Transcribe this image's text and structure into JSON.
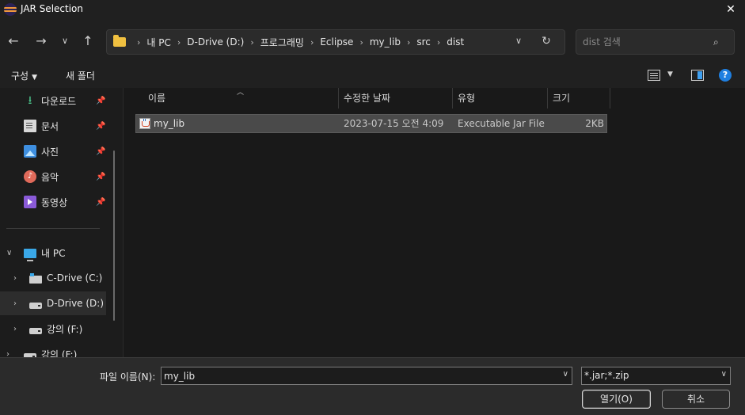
{
  "window": {
    "title": "JAR Selection"
  },
  "nav": {
    "breadcrumbs": [
      "내 PC",
      "D-Drive (D:)",
      "프로그래밍",
      "Eclipse",
      "my_lib",
      "src",
      "dist"
    ],
    "search_placeholder": "dist 검색"
  },
  "toolbar": {
    "organize": "구성",
    "new_folder": "새 폴더"
  },
  "sidebar": {
    "quick_access": [
      {
        "label": "다운로드",
        "icon": "download-icon"
      },
      {
        "label": "문서",
        "icon": "document-icon"
      },
      {
        "label": "사진",
        "icon": "picture-icon"
      },
      {
        "label": "음악",
        "icon": "music-icon"
      },
      {
        "label": "동영상",
        "icon": "video-icon"
      }
    ],
    "pc": {
      "label": "내 PC",
      "drives": [
        {
          "label": "C-Drive (C:)"
        },
        {
          "label": "D-Drive (D:)"
        },
        {
          "label": "강의 (F:)"
        },
        {
          "label": "강의 (F:)"
        }
      ]
    }
  },
  "columns": {
    "name": "이름",
    "date": "수정한 날짜",
    "type": "유형",
    "size": "크기"
  },
  "files": [
    {
      "name": "my_lib",
      "date": "2023-07-15 오전 4:09",
      "type": "Executable Jar File",
      "size": "2KB"
    }
  ],
  "footer": {
    "filename_label": "파일 이름(N):",
    "filename_value": "my_lib",
    "filter_value": "*.jar;*.zip",
    "open_label": "열기(O)",
    "cancel_label": "취소"
  },
  "colors": {
    "accent": "#1f7fe0",
    "selected_row": "#4a4a4a",
    "background": "#191919"
  }
}
